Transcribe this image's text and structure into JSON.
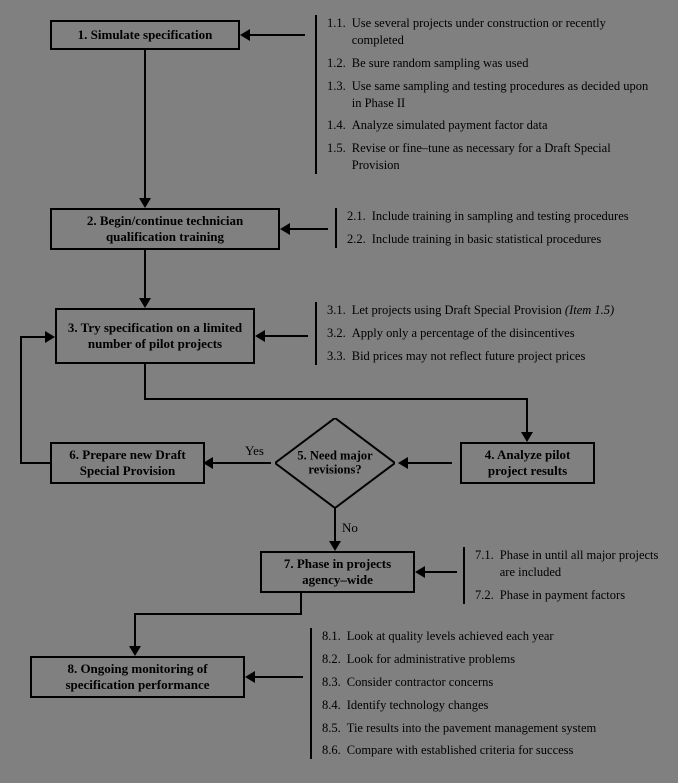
{
  "boxes": {
    "b1": "1. Simulate specification",
    "b2": "2. Begin/continue technician qualification training",
    "b3": "3. Try specification on a limited number of pilot projects",
    "b4": "4. Analyze pilot project results",
    "b5": "5. Need major revisions?",
    "b6": "6. Prepare new Draft Special Provision",
    "b7": "7. Phase in projects agency–wide",
    "b8": "8. Ongoing monitoring of specification performance"
  },
  "labels": {
    "yes": "Yes",
    "no": "No"
  },
  "notes1": [
    {
      "n": "1.1.",
      "t": "Use several projects under construction or recently completed"
    },
    {
      "n": "1.2.",
      "t": "Be sure random sampling was used"
    },
    {
      "n": "1.3.",
      "t": "Use same sampling and testing procedures as decided upon in Phase II"
    },
    {
      "n": "1.4.",
      "t": "Analyze simulated payment factor data"
    },
    {
      "n": "1.5.",
      "t": "Revise or fine–tune as necessary for a Draft Special Provision"
    }
  ],
  "notes2": [
    {
      "n": "2.1.",
      "t": "Include training in sampling and testing procedures"
    },
    {
      "n": "2.2.",
      "t": "Include training in basic statistical procedures"
    }
  ],
  "notes3": [
    {
      "n": "3.1.",
      "t": "Let projects using Draft Special Provision ",
      "i": "(Item 1.5)"
    },
    {
      "n": "3.2.",
      "t": "Apply only a percentage of the disincentives"
    },
    {
      "n": "3.3.",
      "t": "Bid prices may not reflect future project prices"
    }
  ],
  "notes7": [
    {
      "n": "7.1.",
      "t": "Phase in until all major projects are included"
    },
    {
      "n": "7.2.",
      "t": "Phase in payment factors"
    }
  ],
  "notes8": [
    {
      "n": "8.1.",
      "t": "Look at quality levels achieved each year"
    },
    {
      "n": "8.2.",
      "t": "Look for administrative problems"
    },
    {
      "n": "8.3.",
      "t": "Consider contractor concerns"
    },
    {
      "n": "8.4.",
      "t": "Identify technology changes"
    },
    {
      "n": "8.5.",
      "t": "Tie results into the pavement management system"
    },
    {
      "n": "8.6.",
      "t": "Compare with established criteria for success"
    }
  ]
}
